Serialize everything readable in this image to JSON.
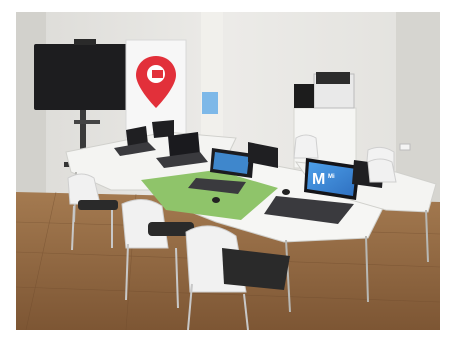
{
  "photo": {
    "subject": "classroom-with-laptops",
    "colors": {
      "wall": "#e7e6e2",
      "floor": "#9a7048",
      "table": "#f4f4f2",
      "mat": "#8fc46a",
      "chair": "#f1f1f1",
      "cushion": "#2a2a2a",
      "screen_blue": "#3a8ad8",
      "banner_red": "#e2303a",
      "tv": "#1d1d1f"
    },
    "screen_text": {
      "big_letter": "M",
      "small_line": "Mi"
    }
  }
}
